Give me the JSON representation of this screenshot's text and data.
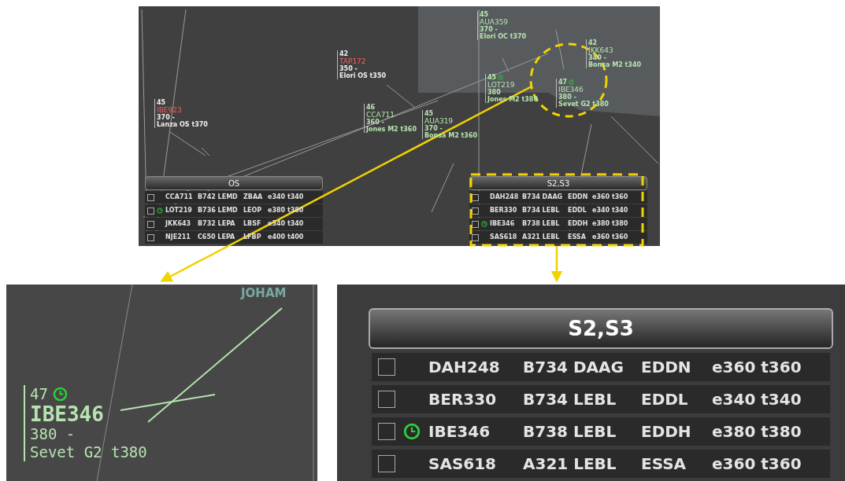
{
  "radar": {
    "tracks": [
      {
        "level": "45",
        "clock": false,
        "callsign": "IBE923",
        "callsign_alert": true,
        "line_3": "370 -",
        "line_4": "Lanza OS t370"
      },
      {
        "level": "42",
        "clock": false,
        "callsign": "TAP172",
        "callsign_alert": true,
        "line_3": "350 -",
        "line_4": "Elori OS t350"
      },
      {
        "level": "46",
        "clock": false,
        "callsign": "CCA711",
        "callsign_alert": false,
        "line_3": "360 -",
        "line_4": "Jones M2 t360"
      },
      {
        "level": "45",
        "clock": false,
        "callsign": "AUA359",
        "callsign_alert": false,
        "line_3": "370 -",
        "line_4": "Elori OC t370"
      },
      {
        "level": "45",
        "clock": true,
        "callsign": "LOT219",
        "callsign_alert": false,
        "line_3": "380",
        "line_4": "Jones M2 t380"
      },
      {
        "level": "47",
        "clock": true,
        "callsign": "IBE346",
        "callsign_alert": false,
        "line_3": "380 -",
        "line_4": "Sevet G2 t380"
      },
      {
        "level": "42",
        "clock": false,
        "callsign": "JKK643",
        "callsign_alert": false,
        "line_3": "340 -",
        "line_4": "Bonsa M2 t340"
      },
      {
        "level": "45",
        "clock": false,
        "callsign": "AUA319",
        "callsign_alert": false,
        "line_3": "370 -",
        "line_4": "Bonsa M2 t360"
      }
    ],
    "lists": [
      {
        "title": "OS",
        "rows": [
          {
            "checked": false,
            "clock": false,
            "cells": [
              "CCA711",
              "B742 LEMD",
              "ZBAA",
              "e340 t340"
            ]
          },
          {
            "checked": false,
            "clock": true,
            "cells": [
              "LOT219",
              "B736 LEMD",
              "LEOP",
              "e380 t380"
            ]
          },
          {
            "checked": false,
            "clock": false,
            "cells": [
              "JKK643",
              "B732 LEPA",
              "LBSF",
              "e340 t340"
            ]
          },
          {
            "checked": false,
            "clock": false,
            "cells": [
              "NJE211",
              "C650 LEPA",
              "LFBP",
              "e400 t400"
            ]
          }
        ]
      },
      {
        "title": "S2,S3",
        "rows": [
          {
            "checked": false,
            "clock": false,
            "cells": [
              "DAH248",
              "B734 DAAG",
              "EDDN",
              "e360 t360"
            ]
          },
          {
            "checked": false,
            "clock": false,
            "cells": [
              "BER330",
              "B734 LEBL",
              "EDDL",
              "e340 t340"
            ]
          },
          {
            "checked": false,
            "clock": true,
            "cells": [
              "IBE346",
              "B738 LEBL",
              "EDDH",
              "e380 t380"
            ]
          },
          {
            "checked": false,
            "clock": false,
            "cells": [
              "SAS618",
              "A321 LEBL",
              "ESSA",
              "e360 t360"
            ]
          }
        ]
      }
    ]
  },
  "left_inset": {
    "waypoint": "JOHAM",
    "track": {
      "level": "47",
      "clock": true,
      "callsign": "IBE346",
      "line_3": "380 -",
      "line_4": "Sevet G2 t380"
    }
  },
  "right_inset": {
    "list": {
      "title": "S2,S3",
      "rows": [
        {
          "checked": false,
          "clock": false,
          "cells": [
            "DAH248",
            "B734 DAAG",
            "EDDN",
            "e360 t360"
          ]
        },
        {
          "checked": false,
          "clock": false,
          "cells": [
            "BER330",
            "B734 LEBL",
            "EDDL",
            "e340 t340"
          ]
        },
        {
          "checked": false,
          "clock": true,
          "cells": [
            "IBE346",
            "B738 LEBL",
            "EDDH",
            "e380 t380"
          ]
        },
        {
          "checked": false,
          "clock": false,
          "cells": [
            "SAS618",
            "A321 LEBL",
            "ESSA",
            "e360 t360"
          ]
        }
      ]
    }
  }
}
